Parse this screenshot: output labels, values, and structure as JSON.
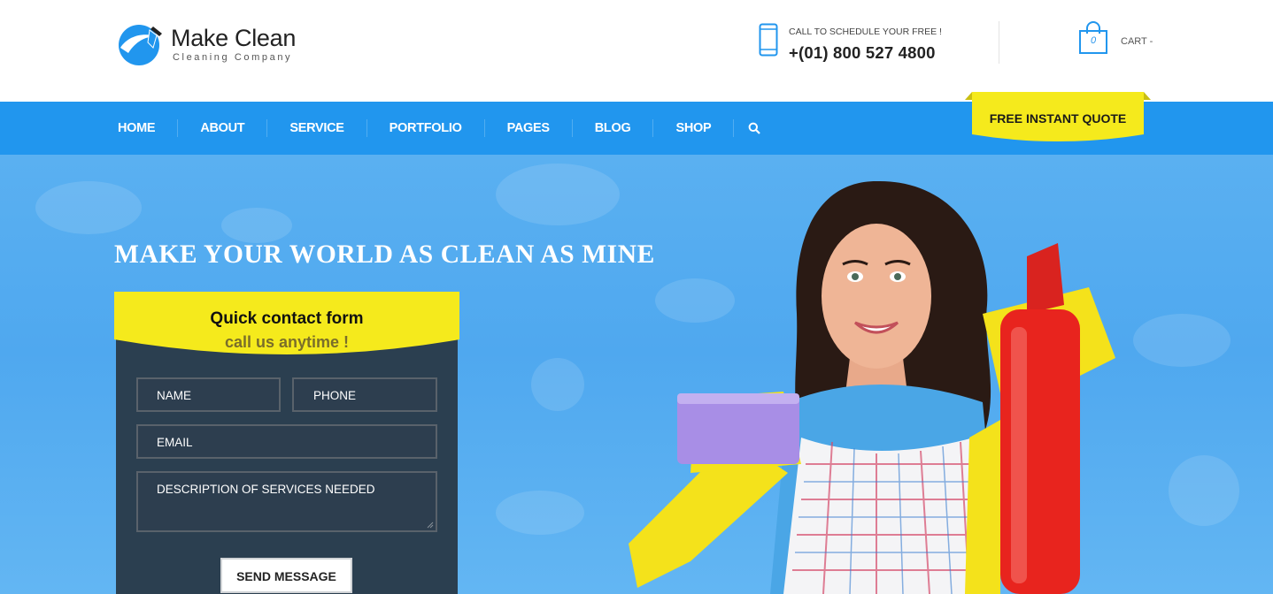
{
  "brand": {
    "name": "Make Clean",
    "tagline": "Cleaning Company"
  },
  "contact": {
    "label": "CALL TO SCHEDULE YOUR FREE !",
    "phone": "+(01) 800 527 4800"
  },
  "cart": {
    "count": "0",
    "label": "CART -"
  },
  "nav": {
    "items": [
      "HOME",
      "ABOUT",
      "SERVICE",
      "PORTFOLIO",
      "PAGES",
      "BLOG",
      "SHOP"
    ],
    "search_icon": "search-icon"
  },
  "quote_button": "FREE INSTANT QUOTE",
  "hero": {
    "headline": "MAKE YOUR WORLD AS CLEAN AS MINE"
  },
  "form": {
    "title": "Quick contact form",
    "subtitle": "call us anytime !",
    "name_placeholder": "NAME",
    "phone_placeholder": "PHONE",
    "email_placeholder": "EMAIL",
    "description_placeholder": "DESCRIPTION OF SERVICES NEEDED",
    "submit_label": "SEND MESSAGE"
  },
  "colors": {
    "primary_blue": "#2196ee",
    "accent_yellow": "#f5ea1c",
    "form_dark": "#2b3f50",
    "hero_blue": "#4fa8ef"
  }
}
